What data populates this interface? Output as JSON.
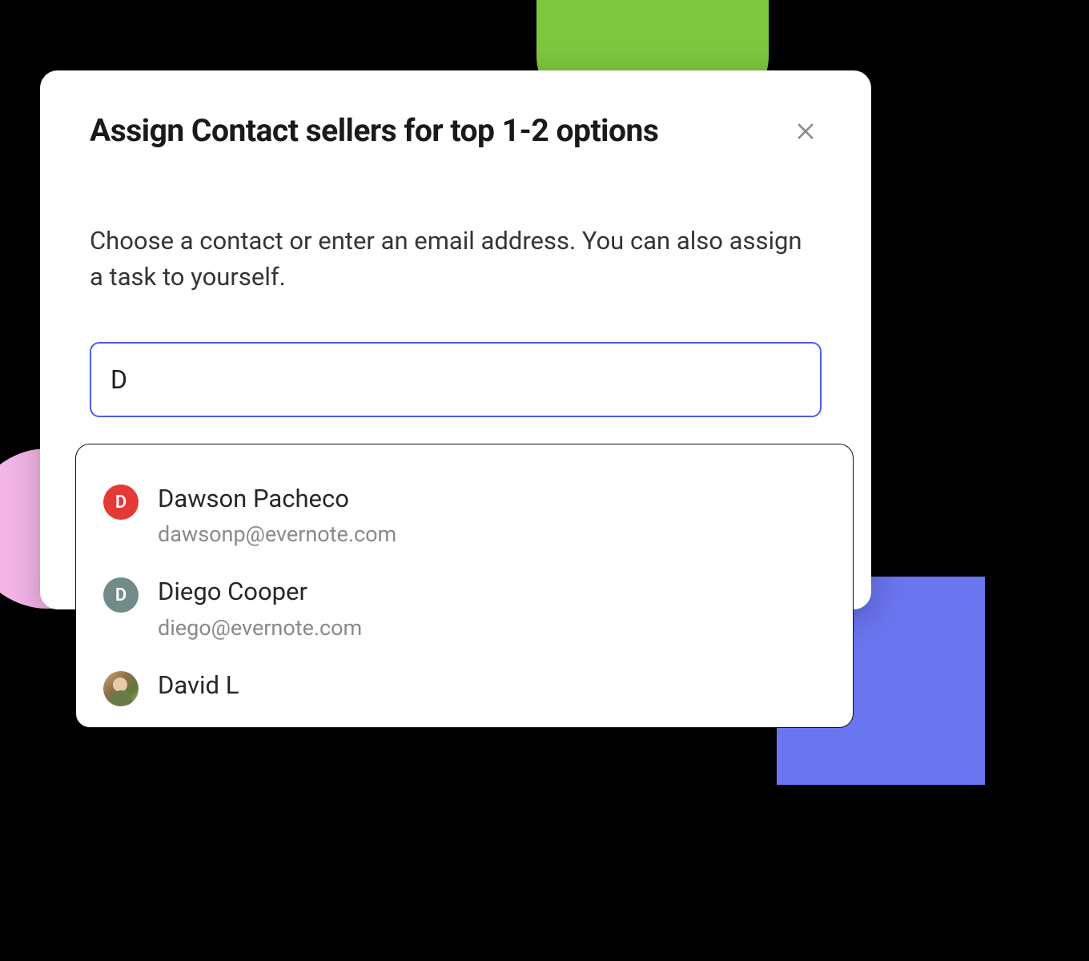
{
  "modal": {
    "title": "Assign Contact sellers for top 1-2 options",
    "description": "Choose a contact or enter an email address. You can also assign a task to yourself.",
    "input_value": "D"
  },
  "dropdown": {
    "items": [
      {
        "initial": "D",
        "name": "Dawson Pacheco",
        "email": "dawsonp@evernote.com",
        "avatar_color": "red"
      },
      {
        "initial": "D",
        "name": "Diego Cooper",
        "email": "diego@evernote.com",
        "avatar_color": "teal"
      },
      {
        "initial": "",
        "name": "David L",
        "email": "",
        "avatar_color": "photo"
      }
    ]
  }
}
